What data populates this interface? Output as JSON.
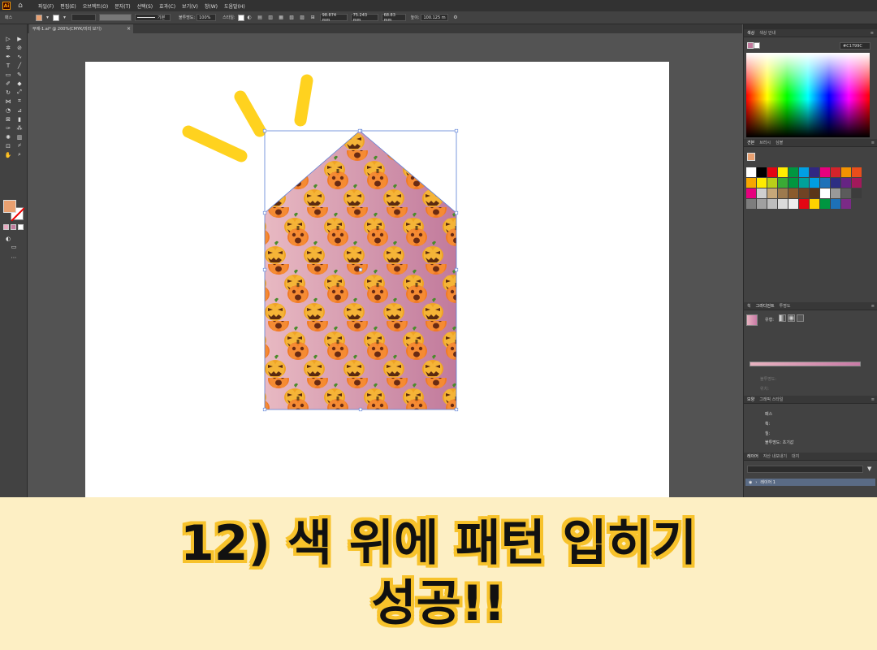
{
  "app": {
    "logo": "Ai"
  },
  "menu": [
    "파일(F)",
    "편집(E)",
    "오브젝트(O)",
    "문자(T)",
    "선택(S)",
    "효과(C)",
    "보기(V)",
    "창(W)",
    "도움말(H)"
  ],
  "control_bar": {
    "label": "패스",
    "stroke_style": "기본",
    "opacity_label": "불투명도:",
    "opacity_value": "100%",
    "style_label": "스타일:",
    "x_value": "98.874 mm",
    "y_value": "75.243 mm",
    "w_value": "68.83 mm",
    "h_label": "높이:",
    "h_value": "100.125 m"
  },
  "document_tab": {
    "title": "무제-1.ai* @ 200%(CMYK/미리 보기)",
    "close": "×"
  },
  "panels": {
    "color": {
      "tabs": [
        "색상",
        "색상 안내"
      ],
      "hex": "C1799C"
    },
    "swatches": {
      "tabs": [
        "견본",
        "브러시",
        "심볼"
      ]
    },
    "gradient": {
      "tabs": [
        "획",
        "그라디언트",
        "투명도"
      ],
      "type_label": "유형:",
      "opacity_label": "불투명도:",
      "location_label": "위치:"
    },
    "appearance": {
      "tabs": [
        "모양",
        "그래픽 스타일"
      ],
      "path_label": "패스",
      "stroke_label": "획:",
      "fill_label": "칠:",
      "opacity_label": "불투명도: 초기값"
    },
    "layers": {
      "tabs": [
        "레이어",
        "자산 내보내기",
        "대지"
      ],
      "layer_name": "레이어 1"
    }
  },
  "colors": {
    "gradient_start": "#e8b9c2",
    "gradient_end": "#c17a9c",
    "selection": "#5b7fd6",
    "sunburst": "#ffd21f",
    "caption_bg": "#fdefc4",
    "caption_outline": "#f7c22b"
  },
  "swatches": [
    "#ffffff",
    "#000000",
    "#e30613",
    "#ffed00",
    "#009640",
    "#009fe3",
    "#312783",
    "#e6007e",
    "#d3232b",
    "#f39200",
    "#e94e1b",
    "#f7a600",
    "#feeb00",
    "#b8cf19",
    "#3aaa35",
    "#00963f",
    "#00a19a",
    "#009ee0",
    "#1d71b8",
    "#2d2e83",
    "#662483",
    "#a3195b",
    "#e6007e",
    "#cfcfcf",
    "#c6a779",
    "#9d7a4e",
    "#8b5b2d",
    "#6f4324",
    "#5a3519",
    "#ffffff",
    "#999999",
    "#5b5b5b",
    "#3c3c3c",
    "#7d7d7d",
    "#a0a0a0",
    "#bdbdbd",
    "#dadada",
    "#eeeeee",
    "#e30613",
    "#ffd200",
    "#009640",
    "#1d71b8",
    "#7b2b87"
  ],
  "caption": {
    "line1": "12) 색 위에 패턴 입히기",
    "line2": "성공!!"
  }
}
